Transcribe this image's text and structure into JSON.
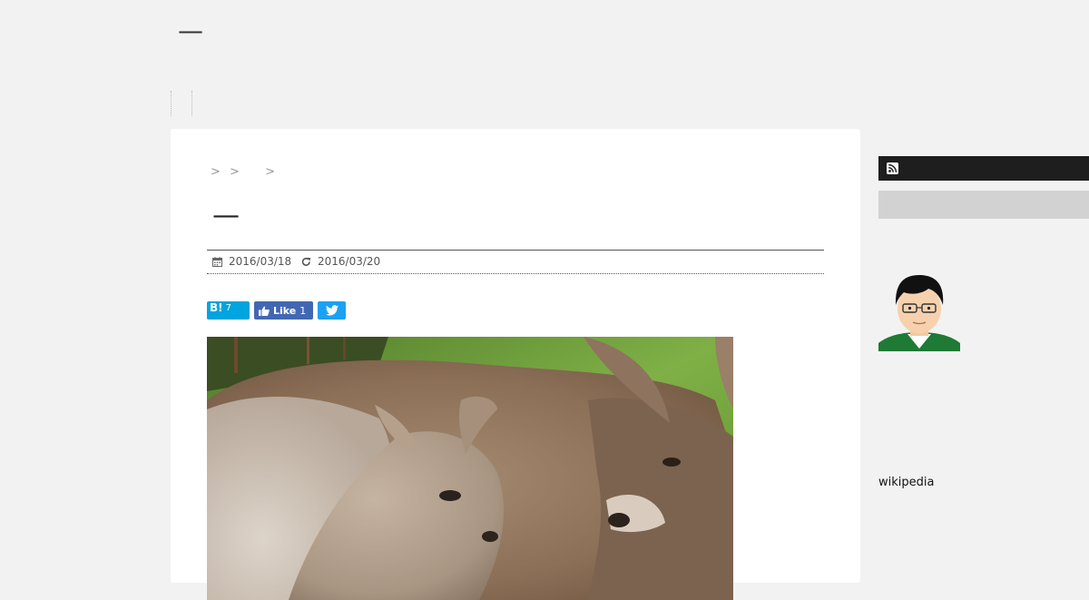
{
  "header": {
    "site_title": "—"
  },
  "breadcrumb": {
    "separators": [
      ">",
      ">",
      ">"
    ]
  },
  "article": {
    "title": "—",
    "published_date": "2016/03/18",
    "updated_date": "2016/03/20",
    "share": {
      "hatena_label": "B!",
      "hatena_count": "7",
      "facebook_label": "Like",
      "facebook_count": "1"
    },
    "image_subject": "kangaroo-mother-and-joey-photo"
  },
  "sidebar": {
    "link_text": "wikipedia",
    "icons": {
      "rss": "rss-icon"
    }
  },
  "colors": {
    "page_bg": "#f2f2f2",
    "card_bg": "#ffffff",
    "hatena": "#00a4de",
    "facebook": "#4267b2",
    "twitter": "#1da1f2",
    "sidebar_dark": "#1e1e1e",
    "sidebar_search": "#d2d2d2"
  }
}
